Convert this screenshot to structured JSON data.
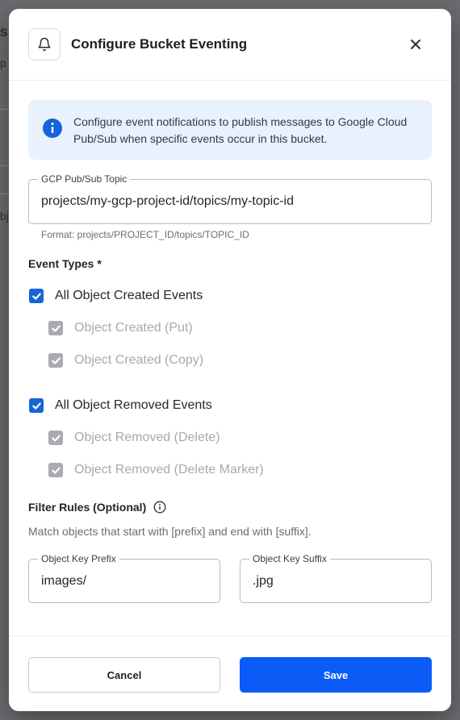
{
  "background": {
    "fragments": [
      "S",
      "p",
      "bj"
    ]
  },
  "dialog": {
    "title": "Configure Bucket Eventing",
    "bell_icon": "bell-icon",
    "close_icon": "close-icon"
  },
  "info": {
    "icon": "info-icon",
    "text": "Configure event notifications to publish messages to Google Cloud Pub/Sub when specific events occur in this bucket."
  },
  "topic": {
    "label": "GCP Pub/Sub Topic",
    "value": "projects/my-gcp-project-id/topics/my-topic-id",
    "helper": "Format: projects/PROJECT_ID/topics/TOPIC_ID"
  },
  "event_types": {
    "title": "Event Types *",
    "groups": [
      {
        "label": "All Object Created Events",
        "checked": true,
        "children": [
          {
            "label": "Object Created (Put)",
            "checked": true
          },
          {
            "label": "Object Created (Copy)",
            "checked": true
          }
        ]
      },
      {
        "label": "All Object Removed Events",
        "checked": true,
        "children": [
          {
            "label": "Object Removed (Delete)",
            "checked": true
          },
          {
            "label": "Object Removed (Delete Marker)",
            "checked": true
          }
        ]
      }
    ]
  },
  "filter": {
    "title": "Filter Rules (Optional)",
    "info_icon": "info-circle-icon",
    "description": "Match objects that start with [prefix] and end with [suffix].",
    "prefix_label": "Object Key Prefix",
    "prefix_value": "images/",
    "suffix_label": "Object Key Suffix",
    "suffix_value": ".jpg"
  },
  "footer": {
    "cancel_label": "Cancel",
    "save_label": "Save"
  },
  "colors": {
    "accent": "#0b5cf7",
    "checkbox": "#1565d8",
    "info_bg": "#e8f1fc"
  }
}
